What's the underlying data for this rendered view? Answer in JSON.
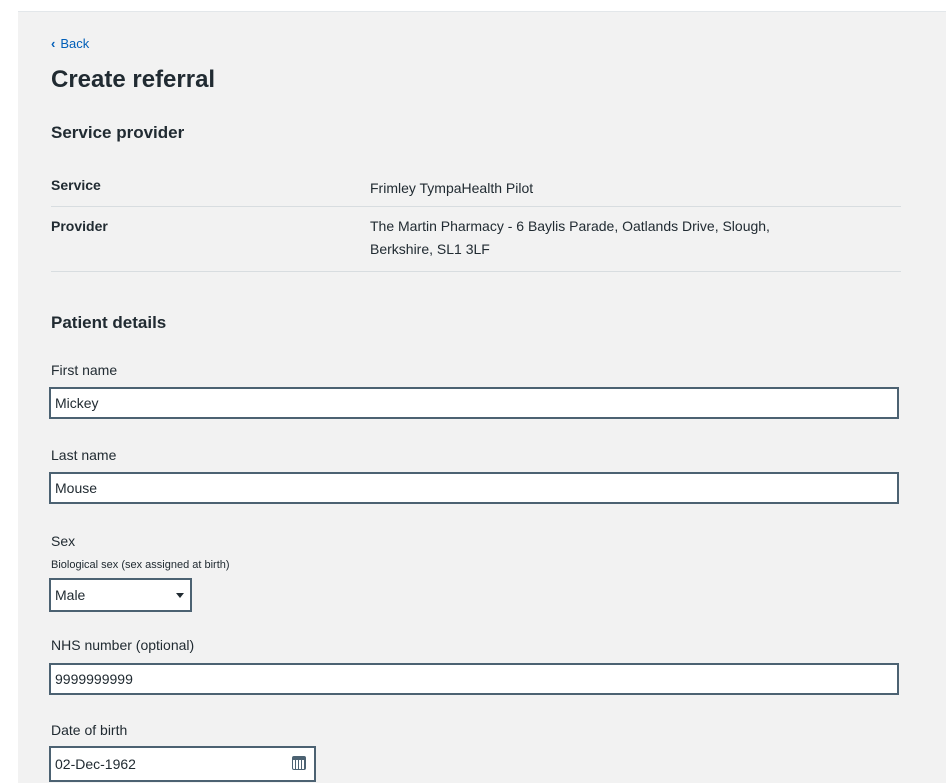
{
  "nav": {
    "back_label": "Back"
  },
  "page": {
    "title": "Create referral"
  },
  "service_provider": {
    "heading": "Service provider",
    "rows": [
      {
        "key": "Service",
        "value": "Frimley TympaHealth Pilot"
      },
      {
        "key": "Provider",
        "value": "The Martin Pharmacy - 6 Baylis Parade, Oatlands Drive, Slough,",
        "value_line2": "Berkshire, SL1 3LF"
      }
    ]
  },
  "patient": {
    "heading": "Patient details",
    "first_name": {
      "label": "First name",
      "value": "Mickey"
    },
    "last_name": {
      "label": "Last name",
      "value": "Mouse"
    },
    "sex": {
      "label": "Sex",
      "hint": "Biological sex (sex assigned at birth)",
      "selected": "Male"
    },
    "nhs_number": {
      "label": "NHS number (optional)",
      "value": "9999999999"
    },
    "dob": {
      "label": "Date of birth",
      "value": "02-Dec-1962"
    }
  },
  "colors": {
    "link": "#005eb8",
    "text": "#212b32",
    "border": "#4c6272",
    "background": "#f2f2f2"
  }
}
